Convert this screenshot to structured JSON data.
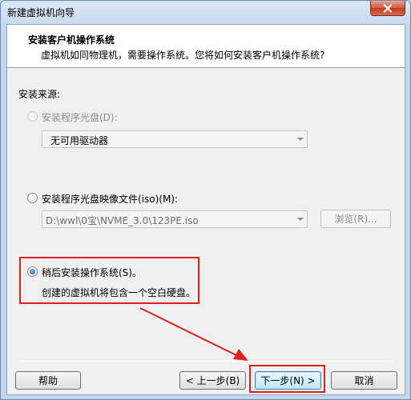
{
  "window": {
    "title": "新建虚拟机向导"
  },
  "header": {
    "title": "安装客户机操作系统",
    "subtitle": "虚拟机如同物理机，需要操作系统。您将如何安装客户机操作系统?"
  },
  "source": {
    "section_label": "安装来源:",
    "options": [
      {
        "label": "安装程序光盘(D):",
        "checked": false,
        "enabled": false
      },
      {
        "label": "安装程序光盘映像文件(iso)(M):",
        "checked": false,
        "enabled": true
      },
      {
        "label": "稍后安装操作系统(S)。",
        "checked": true,
        "enabled": true
      }
    ],
    "disc_drive_value": "无可用驱动器",
    "iso_path_value": "D:\\wwl\\0宝\\NVME_3.0\\123PE.iso",
    "browse_label": "浏览(R)...",
    "later_description": "创建的虚拟机将包含一个空白硬盘。"
  },
  "footer": {
    "help_label": "帮助",
    "back_label": "< 上一步(B)",
    "next_label": "下一步(N) >",
    "cancel_label": "取消"
  },
  "annotation": {
    "color": "#e01f1f"
  }
}
